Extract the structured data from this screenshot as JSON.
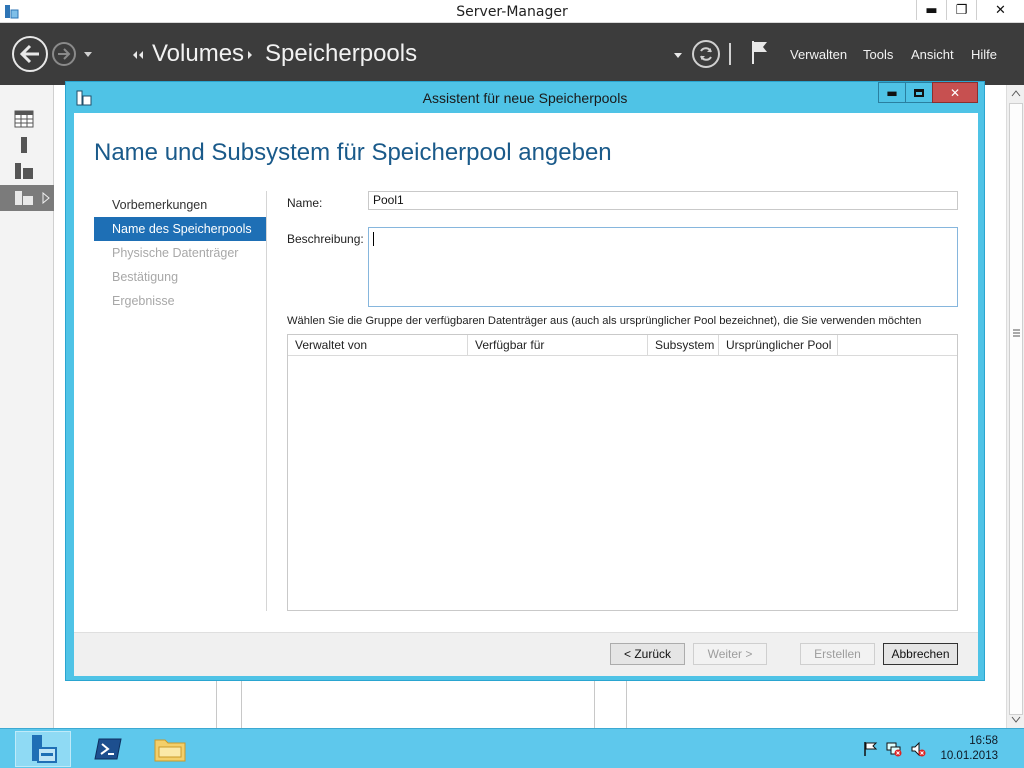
{
  "window": {
    "title": "Server-Manager",
    "minimize_glyph": "▬",
    "maximize_glyph": "❐",
    "close_glyph": "✕"
  },
  "header": {
    "breadcrumb": [
      "Volumes",
      "Speicherpools"
    ],
    "menu": [
      "Verwalten",
      "Tools",
      "Ansicht",
      "Hilfe"
    ]
  },
  "sidebar": {
    "icons": [
      "dashboard-icon",
      "local-server-icon",
      "all-servers-icon",
      "file-storage-icon"
    ]
  },
  "dialog": {
    "title": "Assistent für neue Speicherpools",
    "heading": "Name und Subsystem für Speicherpool angeben",
    "steps": [
      {
        "label": "Vorbemerkungen",
        "state": "normal"
      },
      {
        "label": "Name des Speicherpools",
        "state": "active"
      },
      {
        "label": "Physische Datenträger",
        "state": "disabled"
      },
      {
        "label": "Bestätigung",
        "state": "disabled"
      },
      {
        "label": "Ergebnisse",
        "state": "disabled"
      }
    ],
    "name_label": "Name:",
    "name_value": "Pool1",
    "description_label": "Beschreibung:",
    "description_value": "",
    "group_instruction": "Wählen Sie die Gruppe der verfügbaren Datenträger aus (auch als ursprünglicher Pool bezeichnet), die Sie verwenden möchten",
    "table_columns": [
      "Verwaltet von",
      "Verfügbar für",
      "Subsystem",
      "Ursprünglicher Pool",
      ""
    ],
    "buttons": {
      "back": "< Zurück",
      "next": "Weiter >",
      "create": "Erstellen",
      "cancel": "Abbrechen"
    }
  },
  "taskbar": {
    "time": "16:58",
    "date": "10.01.2013"
  },
  "colors": {
    "accent": "#1e6fb5",
    "dialog_frame": "#4fc3e6",
    "header_bg": "#3c3c3c",
    "taskbar": "#5ec8ec"
  }
}
